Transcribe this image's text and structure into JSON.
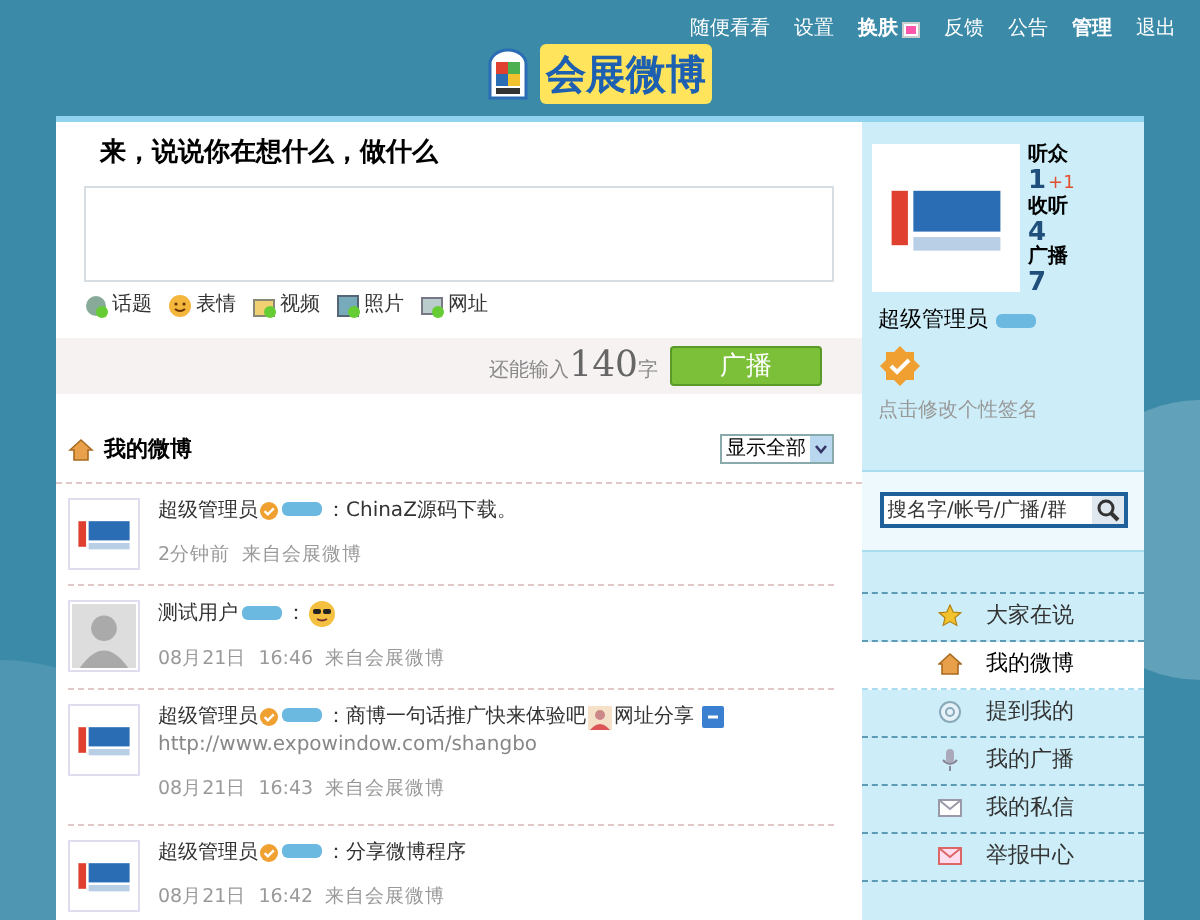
{
  "top_nav": [
    {
      "label": "随便看看",
      "bold": false,
      "has_icon": false
    },
    {
      "label": "设置",
      "bold": false,
      "has_icon": false
    },
    {
      "label": "换肤",
      "bold": true,
      "has_icon": true
    },
    {
      "label": "反馈",
      "bold": false,
      "has_icon": false
    },
    {
      "label": "公告",
      "bold": false,
      "has_icon": false
    },
    {
      "label": "管理",
      "bold": true,
      "has_icon": false
    },
    {
      "label": "退出",
      "bold": false,
      "has_icon": false
    }
  ],
  "logo": {
    "title": "会展微博"
  },
  "compose": {
    "heading": "来，说说你在想什么，做什么",
    "tools": [
      {
        "kind": "topic",
        "label": "话题"
      },
      {
        "kind": "emotion",
        "label": "表情"
      },
      {
        "kind": "video",
        "label": "视频"
      },
      {
        "kind": "photo",
        "label": "照片"
      },
      {
        "kind": "url",
        "label": "网址"
      }
    ],
    "counter_prefix": "还能输入",
    "counter": "140",
    "counter_suffix": "字",
    "submit": "广播"
  },
  "feed": {
    "title": "我的微博",
    "filter": "显示全部",
    "posts": [
      {
        "author": "超级管理员",
        "verified": true,
        "kind": "logo",
        "segments": [
          {
            "kind": "text",
            "text": "：ChinaZ源码下载。"
          }
        ],
        "date": "2分钟前",
        "source": "来自会展微博"
      },
      {
        "author": "测试用户",
        "verified": false,
        "kind": "silhouette",
        "segments": [
          {
            "kind": "text",
            "text": "："
          },
          {
            "kind": "face"
          }
        ],
        "date": "08月21日",
        "time": "16:46",
        "source": "来自会展微博"
      },
      {
        "author": "超级管理员",
        "verified": true,
        "kind": "logo",
        "segments": [
          {
            "kind": "text",
            "text": "：商博一句话推广快来体验吧"
          },
          {
            "kind": "person"
          },
          {
            "kind": "text",
            "text": "网址分享 "
          },
          {
            "kind": "link_badge"
          },
          {
            "kind": "link",
            "text": "http://www.expowindow.com/shangbo"
          }
        ],
        "date": "08月21日",
        "time": "16:43",
        "source": "来自会展微博"
      },
      {
        "author": "超级管理员",
        "verified": true,
        "kind": "logo",
        "segments": [
          {
            "kind": "text",
            "text": "：分享微博程序"
          }
        ],
        "date": "08月21日",
        "time": "16:42",
        "source": "来自会展微博"
      }
    ]
  },
  "profile": {
    "stats": [
      {
        "label": "听众",
        "value": "1",
        "delta": "+1"
      },
      {
        "label": "收听",
        "value": "4"
      },
      {
        "label": "广播",
        "value": "7"
      }
    ],
    "name": "超级管理员",
    "verified": true,
    "signature": "点击修改个性签名"
  },
  "search": {
    "placeholder": "搜名字/帐号/广播/群"
  },
  "sidebar": {
    "items": [
      {
        "kind": "star",
        "label": "大家在说",
        "selected": false
      },
      {
        "kind": "house",
        "label": "我的微博",
        "selected": true
      },
      {
        "kind": "at",
        "label": "提到我的",
        "selected": false
      },
      {
        "kind": "mic",
        "label": "我的广播",
        "selected": false
      },
      {
        "kind": "mail",
        "label": "我的私信",
        "selected": false
      },
      {
        "kind": "mail_red",
        "label": "举报中心",
        "selected": false
      }
    ]
  }
}
